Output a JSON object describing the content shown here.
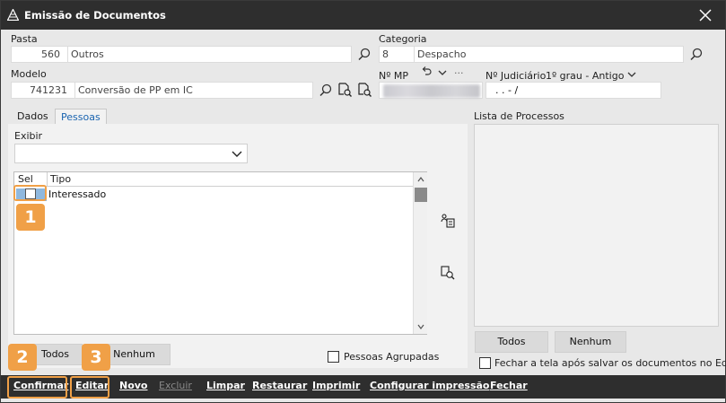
{
  "window": {
    "title": "Emissão de Documentos"
  },
  "pasta": {
    "label": "Pasta",
    "code": "560",
    "value": "Outros"
  },
  "categoria": {
    "label": "Categoria",
    "code": "8",
    "value": "Despacho"
  },
  "modelo": {
    "label": "Modelo",
    "code": "741231",
    "value": "Conversão de PP em IC"
  },
  "nmp": {
    "label": "Nº MP",
    "more": "···"
  },
  "judiciario": {
    "label": "Nº Judiciário",
    "grau": "1º grau - Antigo",
    "value": ". .   - /"
  },
  "tabs": [
    {
      "label": "Dados",
      "active": false
    },
    {
      "label": "Pessoas",
      "active": true
    }
  ],
  "exibir": {
    "label": "Exibir",
    "value": ""
  },
  "grid": {
    "columns": [
      "Sel",
      "Tipo"
    ],
    "rows": [
      {
        "checked": false,
        "tipo": "Interessado"
      }
    ]
  },
  "buttons": {
    "todos": "Todos",
    "nenhum": "Nenhum",
    "pessoas_agrupadas": "Pessoas Agrupadas",
    "todos_right": "Todos",
    "nenhum_right": "Nenhum",
    "fechar_tela": "Fechar a tela após salvar os documentos no Editor"
  },
  "lista_processos": {
    "label": "Lista de Processos"
  },
  "bottom": {
    "confirmar": "Confirmar",
    "editar": "Editar",
    "novo": "Novo",
    "excluir": "Excluir",
    "limpar": "Limpar",
    "restaurar": "Restaurar",
    "imprimir": "Imprimir",
    "configurar": "Configurar impressão",
    "fechar": "Fechar"
  },
  "callouts": [
    "1",
    "2",
    "3"
  ],
  "colors": {
    "accent": "#f0a047",
    "titlebar": "#2e2e2e",
    "selection": "#8fb8de",
    "tab_active": "#1a64b0"
  }
}
